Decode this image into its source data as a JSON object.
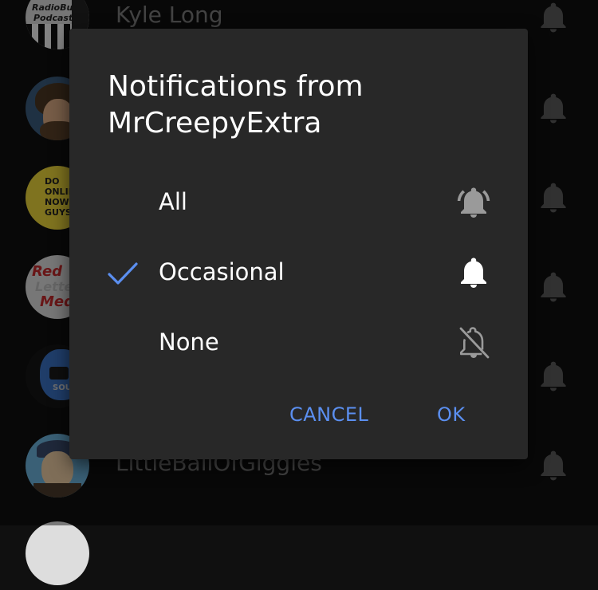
{
  "subscriptions": [
    {
      "name": "Kyle Long",
      "avatar_text": "RadioBuys Podcast",
      "avatar_color": "#d8d8d8"
    },
    {
      "name": "",
      "avatar_text": "",
      "avatar_color": "#6a5a3c"
    },
    {
      "name": "",
      "avatar_text": "DO ONLIN NOW GUYS",
      "avatar_color": "#e8d23a"
    },
    {
      "name": "",
      "avatar_text": "Red Lette Med",
      "avatar_color": "#d9d9d9"
    },
    {
      "name": "",
      "avatar_text": "SOU",
      "avatar_color": "#1a1a1a"
    },
    {
      "name": "LittleBallOfGiggles",
      "avatar_text": "",
      "avatar_color": "#6ab0d8"
    }
  ],
  "dialog": {
    "title": "Notifications from MrCreepyExtra",
    "options": [
      {
        "label": "All",
        "icon": "bell-ringing-icon",
        "selected": false
      },
      {
        "label": "Occasional",
        "icon": "bell-icon",
        "selected": true
      },
      {
        "label": "None",
        "icon": "bell-off-icon",
        "selected": false
      }
    ],
    "cancel_label": "CANCEL",
    "ok_label": "OK"
  },
  "colors": {
    "accent": "#5b8ff0",
    "dialog_bg": "#282828",
    "page_bg": "#101010"
  }
}
